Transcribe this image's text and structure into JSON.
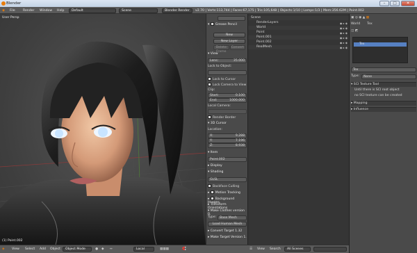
{
  "window": {
    "title": "Blender"
  },
  "info": {
    "menus": [
      "File",
      "Render",
      "Window",
      "Help"
    ],
    "screen_layout": "Default",
    "scene": "Scene",
    "render_engine": "Blender Render",
    "stats": "v2.70 | Verts:113,744 | Faces:67,175 | Tris:105,648 | Objects:1/10 | Lamps:1/3 | Mem:356.62M | Point.002"
  },
  "viewport": {
    "label": "User Persp",
    "status": "(1) Point.002",
    "toolbar": [
      "View",
      "Select",
      "Add",
      "Object",
      "Object Mode",
      "Local"
    ]
  },
  "npanel": {
    "grease_pencil": "Grease Pencil",
    "new": "New",
    "new_layer": "New Layer",
    "delete_frame": "Delete Frame",
    "convert": "Convert",
    "view": "View",
    "lens_label": "Lens:",
    "lens": "35.000",
    "lock_to_object": "Lock to Object:",
    "lock_to_cursor": "Lock to Cursor",
    "lock_camera": "Lock Camera to View",
    "clip": "Clip:",
    "clip_start_label": "Start:",
    "clip_start": "0.100",
    "clip_end_label": "End:",
    "clip_end": "1000.000",
    "local_camera": "Local Camera:",
    "render_border": "Render Border",
    "cursor_3d": "3D Cursor",
    "location": "Location:",
    "x_label": "X:",
    "x": "9.288",
    "y_label": "Y:",
    "y": "7.196",
    "z_label": "Z:",
    "z": "8.938",
    "item": "Item",
    "item_name": "Point.002",
    "display": "Display",
    "shading": "Shading",
    "glsl": "GLSL",
    "backface_culling": "Backface Culling",
    "motion_tracking": "Motion Tracking",
    "background_images": "Background Images",
    "transform_orientations": "Transform Orientations",
    "make_clothes": "Make Clothes version 0.",
    "type_label": "Type:",
    "type_value": "Base Mesh",
    "load_human": "Load Human Mesh",
    "convert_target": "Convert Target 1.32",
    "make_target": "Make Target Version 1."
  },
  "outliner": {
    "rows": [
      {
        "label": "Scene",
        "indent": 0
      },
      {
        "label": "RenderLayers",
        "indent": 1
      },
      {
        "label": "World",
        "indent": 1
      },
      {
        "label": "Point",
        "indent": 1
      },
      {
        "label": "Point.001",
        "indent": 1
      },
      {
        "label": "Point.002",
        "indent": 1
      },
      {
        "label": "RealMesh",
        "indent": 1
      }
    ],
    "footer": [
      "View",
      "Search",
      "All Scenes"
    ]
  },
  "props": {
    "context": "World",
    "tex": "Tex",
    "slots": [
      "",
      "Tex",
      "",
      "",
      "",
      ""
    ],
    "tex_name": "Tex",
    "type_label": "Type:",
    "type_value": "None",
    "sci_tools": "SCI Texture Tool",
    "sci_msg1": "Until there is SCI root object",
    "sci_msg2": "no SCI texture can be created",
    "mapping": "Mapping",
    "influence": "Influence"
  },
  "colors": {
    "accent": "#e87d0d",
    "selection": "#5680c2",
    "panel": "#4a4a4a"
  }
}
